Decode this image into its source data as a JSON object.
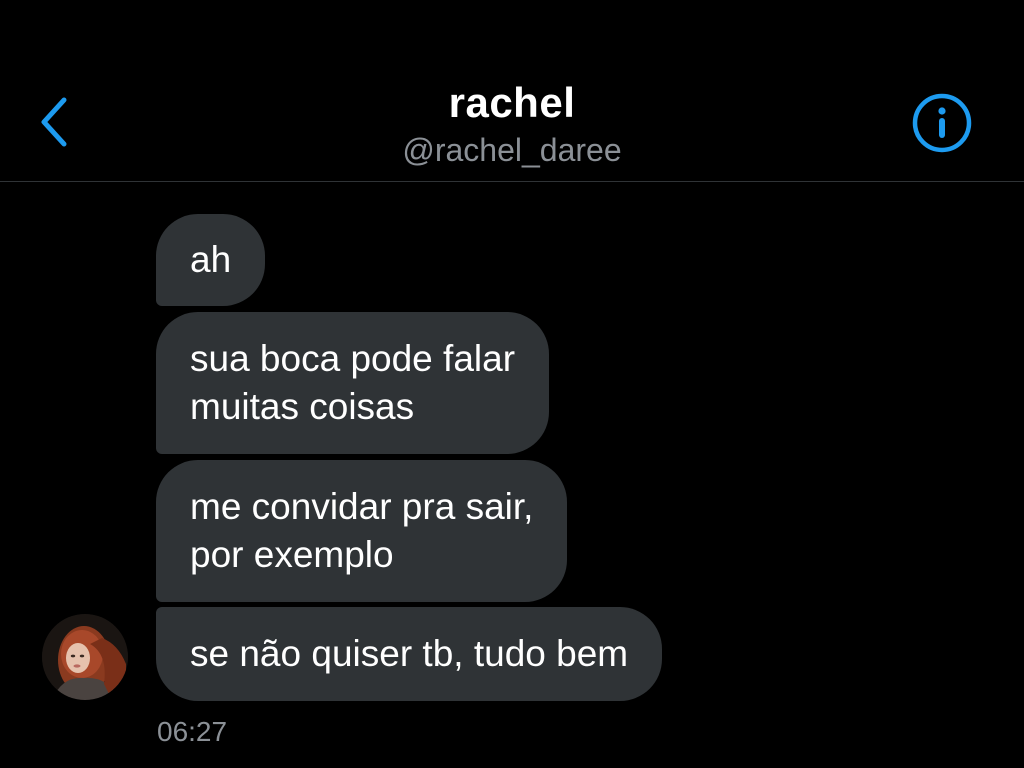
{
  "header": {
    "title": "rachel",
    "handle": "@rachel_daree",
    "back_icon": "chevron-left-icon",
    "info_icon": "info-icon"
  },
  "messages": [
    {
      "text": "ah"
    },
    {
      "text": "sua boca pode falar\nmuitas coisas"
    },
    {
      "text": "me convidar pra sair,\npor exemplo"
    },
    {
      "text": "se não quiser tb, tudo bem"
    }
  ],
  "timestamp": "06:27",
  "colors": {
    "accent": "#1d9bf0",
    "bubble": "#2f3336",
    "background": "#000000",
    "muted_text": "#8b9096"
  }
}
